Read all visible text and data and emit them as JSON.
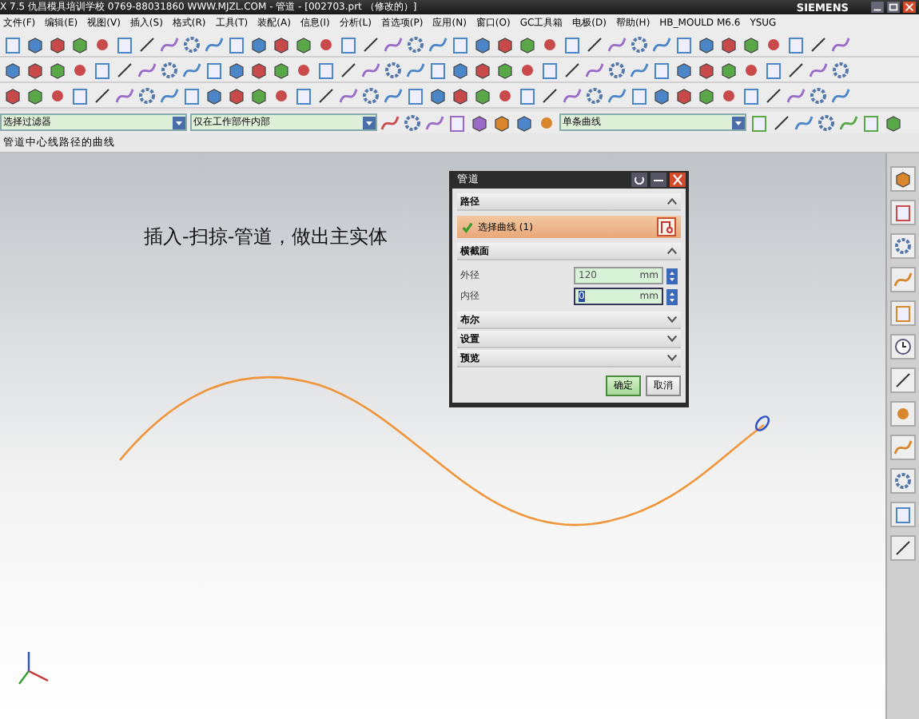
{
  "window": {
    "title": "X 7.5  仇昌模具培训学校  0769-88031860  WWW.MJZL.COM - 管道 - [002703.prt （修改的）]",
    "brand": "SIEMENS"
  },
  "menu": [
    "文件(F)",
    "编辑(E)",
    "视图(V)",
    "插入(S)",
    "格式(R)",
    "工具(T)",
    "装配(A)",
    "信息(I)",
    "分析(L)",
    "首选项(P)",
    "应用(N)",
    "窗口(O)",
    "GC工具箱",
    "电极(D)",
    "帮助(H)",
    "HB_MOULD M6.6",
    "YSUG"
  ],
  "selection_bar": {
    "filter": "选择过滤器",
    "scope": "仅在工作部件内部",
    "curve_rule": "单条曲线"
  },
  "prompt": "管道中心线路径的曲线",
  "annotation": "插入-扫掠-管道，做出主实体",
  "dialog": {
    "title": "管道",
    "sections": [
      {
        "title": "路径",
        "expanded": true,
        "kind": "selection",
        "selection": {
          "label": "选择曲线 (1)",
          "checked": true
        }
      },
      {
        "title": "横截面",
        "expanded": true,
        "kind": "fields",
        "fields": [
          {
            "label": "外径",
            "value": "120",
            "unit": "mm",
            "focused": false
          },
          {
            "label": "内径",
            "value": "0",
            "unit": "mm",
            "focused": true
          }
        ]
      },
      {
        "title": "布尔",
        "expanded": false
      },
      {
        "title": "设置",
        "expanded": false
      },
      {
        "title": "预览",
        "expanded": false
      }
    ],
    "buttons": [
      {
        "label": "确定",
        "default": true
      },
      {
        "label": "取消",
        "default": false
      }
    ]
  }
}
